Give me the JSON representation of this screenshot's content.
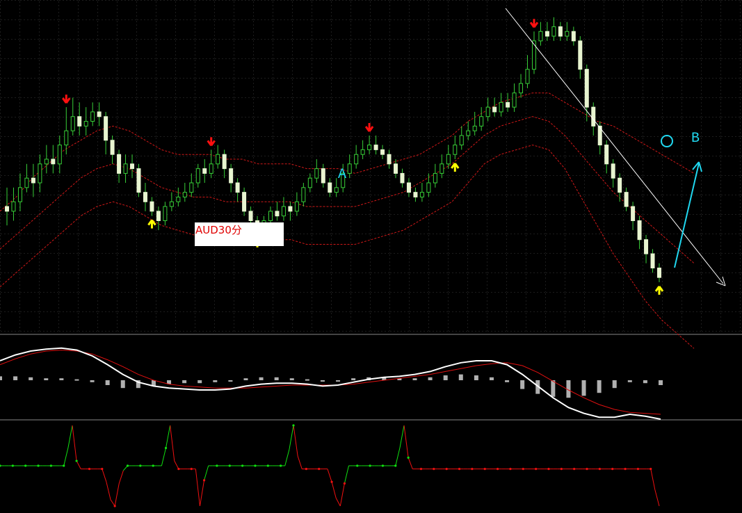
{
  "title_label": "AUD30分",
  "annotations": {
    "point_a": "A",
    "point_b": "B",
    "point_o": "O"
  },
  "colors": {
    "background": "#000000",
    "grid": "#3a3a3a",
    "bull_candle": "#e8f5d0",
    "bear_candle": "#e8f5d0",
    "candle_wick": "#38d038",
    "band": "#d01818",
    "arrow_up": "#ffff00",
    "arrow_down": "#ff1010",
    "trendline": "#ffffff",
    "annotation": "#20d8f0",
    "macd_main": "#ffffff",
    "macd_signal": "#e01010",
    "macd_hist": "#b0b0b0",
    "osc_up": "#10e010",
    "osc_down": "#f01010"
  },
  "chart_data": [
    {
      "type": "candlestick",
      "panel": "main",
      "title": "AUD30分",
      "grid": true,
      "ylim": [
        0,
        100
      ],
      "candles": [
        [
          71,
          70,
          75,
          67
        ],
        [
          70,
          72,
          75,
          68
        ],
        [
          72,
          75,
          78,
          70
        ],
        [
          75,
          77,
          80,
          74
        ],
        [
          77,
          76,
          80,
          73
        ],
        [
          76,
          80,
          82,
          74
        ],
        [
          80,
          81,
          84,
          78
        ],
        [
          81,
          80,
          84,
          78
        ],
        [
          80,
          84,
          86,
          78
        ],
        [
          84,
          87,
          92,
          82
        ],
        [
          87,
          90,
          94,
          86
        ],
        [
          90,
          88,
          93,
          86
        ],
        [
          88,
          89,
          92,
          86
        ],
        [
          89,
          91,
          93,
          88
        ],
        [
          91,
          90,
          93,
          88
        ],
        [
          90,
          85,
          91,
          82
        ],
        [
          85,
          82,
          86,
          80
        ],
        [
          82,
          78,
          83,
          76
        ],
        [
          78,
          80,
          82,
          76
        ],
        [
          80,
          79,
          82,
          77
        ],
        [
          79,
          74,
          80,
          73
        ],
        [
          74,
          72,
          76,
          70
        ],
        [
          72,
          70,
          73,
          69
        ],
        [
          70,
          68,
          71,
          66
        ],
        [
          68,
          71,
          72,
          67
        ],
        [
          71,
          72,
          74,
          70
        ],
        [
          72,
          73,
          75,
          71
        ],
        [
          73,
          74,
          76,
          72
        ],
        [
          74,
          76,
          78,
          73
        ],
        [
          76,
          79,
          80,
          75
        ],
        [
          79,
          78,
          81,
          76
        ],
        [
          78,
          80,
          83,
          77
        ],
        [
          80,
          82,
          84,
          79
        ],
        [
          82,
          79,
          83,
          77
        ],
        [
          79,
          76,
          80,
          74
        ],
        [
          76,
          74,
          77,
          72
        ],
        [
          74,
          70,
          75,
          69
        ],
        [
          70,
          68,
          71,
          66
        ],
        [
          68,
          66,
          69,
          65
        ],
        [
          66,
          68,
          69,
          65
        ],
        [
          68,
          70,
          71,
          67
        ],
        [
          70,
          69,
          72,
          68
        ],
        [
          69,
          71,
          73,
          68
        ],
        [
          71,
          70,
          72,
          68
        ],
        [
          70,
          72,
          74,
          69
        ],
        [
          72,
          75,
          76,
          71
        ],
        [
          75,
          77,
          78,
          74
        ],
        [
          77,
          79,
          81,
          76
        ],
        [
          79,
          76,
          80,
          75
        ],
        [
          76,
          74,
          77,
          73
        ],
        [
          74,
          75,
          77,
          73
        ],
        [
          75,
          78,
          80,
          74
        ],
        [
          78,
          80,
          82,
          77
        ],
        [
          80,
          82,
          84,
          79
        ],
        [
          82,
          83,
          85,
          81
        ],
        [
          83,
          84,
          86,
          82
        ],
        [
          84,
          83,
          86,
          82
        ],
        [
          83,
          82,
          84,
          81
        ],
        [
          82,
          80,
          83,
          79
        ],
        [
          80,
          78,
          81,
          77
        ],
        [
          78,
          76,
          79,
          75
        ],
        [
          76,
          74,
          77,
          73
        ],
        [
          74,
          73,
          75,
          72
        ],
        [
          73,
          74,
          76,
          72
        ],
        [
          74,
          76,
          78,
          73
        ],
        [
          76,
          78,
          80,
          75
        ],
        [
          78,
          80,
          82,
          77
        ],
        [
          80,
          82,
          84,
          79
        ],
        [
          82,
          84,
          86,
          81
        ],
        [
          84,
          86,
          88,
          83
        ],
        [
          86,
          87,
          89,
          85
        ],
        [
          87,
          88,
          91,
          86
        ],
        [
          88,
          90,
          92,
          87
        ],
        [
          90,
          92,
          94,
          89
        ],
        [
          92,
          91,
          94,
          90
        ],
        [
          91,
          93,
          95,
          90
        ],
        [
          93,
          92,
          95,
          91
        ],
        [
          92,
          95,
          97,
          91
        ],
        [
          95,
          97,
          99,
          94
        ],
        [
          97,
          100,
          103,
          96
        ],
        [
          100,
          106,
          108,
          99
        ],
        [
          106,
          108,
          110,
          105
        ],
        [
          108,
          107,
          110,
          106
        ],
        [
          107,
          109,
          111,
          106
        ],
        [
          109,
          107,
          110,
          106
        ],
        [
          107,
          108,
          110,
          106
        ],
        [
          108,
          106,
          109,
          105
        ],
        [
          106,
          100,
          107,
          98
        ],
        [
          100,
          92,
          101,
          89
        ],
        [
          92,
          88,
          93,
          86
        ],
        [
          88,
          84,
          89,
          82
        ],
        [
          84,
          80,
          85,
          78
        ],
        [
          80,
          77,
          81,
          75
        ],
        [
          77,
          74,
          78,
          72
        ],
        [
          74,
          71,
          75,
          70
        ],
        [
          71,
          68,
          72,
          66
        ],
        [
          68,
          64,
          69,
          62
        ],
        [
          64,
          61,
          65,
          59
        ],
        [
          61,
          58,
          62,
          57
        ],
        [
          58,
          56,
          59,
          55
        ]
      ],
      "upper_band": [
        70,
        73,
        77,
        80,
        83,
        85,
        87,
        88,
        87,
        85,
        83,
        82,
        82,
        82,
        81,
        81,
        80,
        80,
        80,
        79,
        79,
        79,
        78,
        79,
        80,
        81,
        82,
        84,
        86,
        89,
        91,
        93,
        94,
        95,
        95,
        93,
        91,
        89,
        88,
        86,
        84,
        82,
        80,
        78
      ],
      "middle_band": [
        62,
        65,
        68,
        71,
        74,
        77,
        79,
        80,
        79,
        77,
        75,
        74,
        73,
        73,
        72,
        72,
        72,
        72,
        72,
        71,
        71,
        71,
        71,
        72,
        73,
        74,
        76,
        78,
        80,
        83,
        86,
        88,
        89,
        90,
        89,
        86,
        82,
        78,
        74,
        71,
        68,
        65,
        62,
        59
      ],
      "lower_band": [
        54,
        57,
        60,
        63,
        66,
        69,
        71,
        72,
        71,
        69,
        67,
        66,
        65,
        65,
        64,
        64,
        64,
        64,
        64,
        63,
        63,
        63,
        63,
        64,
        65,
        66,
        68,
        70,
        72,
        76,
        80,
        82,
        83,
        84,
        83,
        79,
        73,
        67,
        61,
        56,
        51,
        47,
        44,
        41
      ],
      "signals": [
        {
          "index": 9,
          "direction": "down"
        },
        {
          "index": 22,
          "direction": "up"
        },
        {
          "index": 31,
          "direction": "down"
        },
        {
          "index": 38,
          "direction": "up"
        },
        {
          "index": 55,
          "direction": "down"
        },
        {
          "index": 68,
          "direction": "up"
        },
        {
          "index": 80,
          "direction": "down"
        },
        {
          "index": 99,
          "direction": "up"
        }
      ]
    },
    {
      "type": "line",
      "panel": "macd",
      "grid": false,
      "series": [
        {
          "role": "main",
          "values": [
            2.0,
            2.6,
            3.0,
            3.2,
            3.3,
            3.1,
            2.5,
            1.6,
            0.6,
            -0.2,
            -0.6,
            -0.8,
            -0.9,
            -1.0,
            -1.0,
            -0.9,
            -0.6,
            -0.4,
            -0.3,
            -0.3,
            -0.4,
            -0.6,
            -0.5,
            -0.2,
            0.1,
            0.3,
            0.4,
            0.6,
            0.9,
            1.4,
            1.8,
            2.0,
            2.0,
            1.6,
            0.6,
            -0.6,
            -1.8,
            -2.8,
            -3.4,
            -3.8,
            -3.8,
            -3.5,
            -3.7,
            -4.0
          ]
        },
        {
          "role": "signal",
          "values": [
            1.6,
            2.2,
            2.7,
            3.0,
            3.1,
            3.0,
            2.7,
            2.1,
            1.4,
            0.6,
            0.0,
            -0.4,
            -0.6,
            -0.7,
            -0.8,
            -0.8,
            -0.8,
            -0.7,
            -0.6,
            -0.5,
            -0.5,
            -0.5,
            -0.5,
            -0.4,
            -0.2,
            0.0,
            0.2,
            0.4,
            0.6,
            0.9,
            1.2,
            1.5,
            1.7,
            1.8,
            1.5,
            0.8,
            -0.1,
            -1.0,
            -1.8,
            -2.5,
            -3.0,
            -3.3,
            -3.4,
            -3.5
          ]
        },
        {
          "role": "histogram",
          "values": [
            0.4,
            0.4,
            0.3,
            0.2,
            0.2,
            0.1,
            -0.2,
            -0.5,
            -0.8,
            -0.8,
            -0.6,
            -0.4,
            -0.3,
            -0.3,
            -0.2,
            -0.1,
            0.2,
            0.3,
            0.3,
            0.2,
            0.1,
            -0.1,
            0.0,
            0.2,
            0.3,
            0.3,
            0.2,
            0.2,
            0.3,
            0.5,
            0.6,
            0.5,
            0.3,
            -0.2,
            -0.9,
            -1.4,
            -1.7,
            -1.8,
            -1.6,
            -1.3,
            -0.8,
            -0.2,
            -0.3,
            -0.5
          ]
        }
      ]
    },
    {
      "type": "line",
      "panel": "oscillator",
      "grid": false,
      "ylim": [
        0,
        100
      ],
      "series": [
        {
          "role": "state",
          "values": [
            50,
            50,
            50,
            50,
            50,
            50,
            50,
            50,
            50,
            50,
            50,
            50,
            50,
            50,
            50,
            50,
            72,
            100,
            56,
            46,
            46,
            46,
            46,
            46,
            46,
            30,
            8,
            0,
            28,
            44,
            50,
            50,
            50,
            50,
            50,
            50,
            50,
            50,
            50,
            72,
            100,
            56,
            46,
            46,
            46,
            46,
            46,
            0,
            32,
            50,
            50,
            50,
            50,
            50,
            50,
            50,
            50,
            50,
            50,
            50,
            50,
            50,
            50,
            50,
            50,
            50,
            50,
            50,
            70,
            100,
            62,
            46,
            46,
            46,
            46,
            46,
            46,
            46,
            30,
            10,
            0,
            28,
            50,
            50,
            50,
            50,
            50,
            50,
            50,
            50,
            50,
            50,
            50,
            50,
            72,
            100,
            60,
            46,
            46,
            46,
            46,
            46,
            46,
            46,
            46,
            46,
            46,
            46,
            46,
            46,
            46,
            46,
            46,
            46,
            46,
            46,
            46,
            46,
            46,
            46,
            46,
            46,
            46,
            46,
            46,
            46,
            46,
            46,
            46,
            46,
            46,
            46,
            46,
            46,
            46,
            46,
            46,
            46,
            46,
            46,
            46,
            46,
            46,
            46,
            46,
            46,
            46,
            46,
            46,
            46,
            46,
            46,
            46,
            46,
            20,
            0
          ]
        }
      ]
    }
  ]
}
